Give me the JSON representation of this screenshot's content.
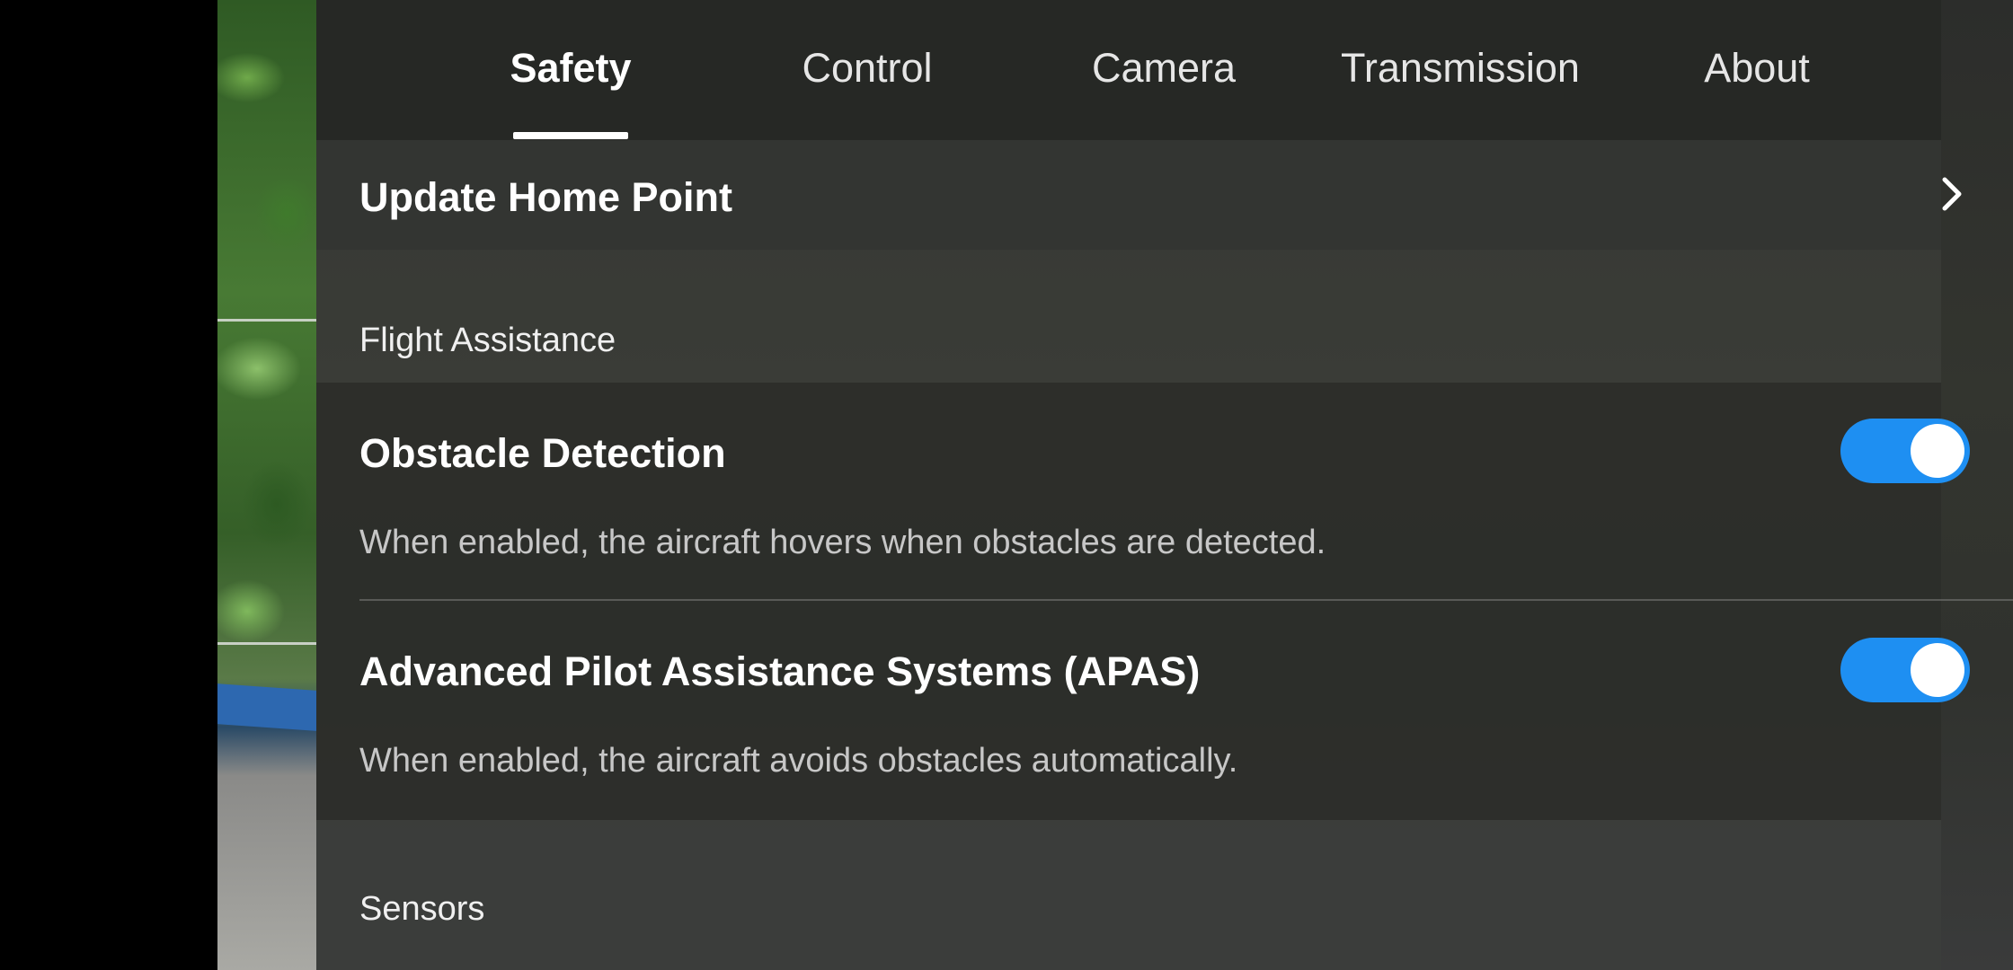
{
  "tabs": [
    {
      "label": "Safety",
      "active": true
    },
    {
      "label": "Control",
      "active": false
    },
    {
      "label": "Camera",
      "active": false
    },
    {
      "label": "Transmission",
      "active": false
    },
    {
      "label": "About",
      "active": false
    }
  ],
  "home_point": {
    "label": "Update Home Point",
    "icon": "chevron-right-icon"
  },
  "flight_assistance": {
    "section_label": "Flight Assistance",
    "obstacle_detection": {
      "title": "Obstacle Detection",
      "description": "When enabled, the aircraft hovers when obstacles are detected.",
      "enabled": true
    },
    "apas": {
      "title": "Advanced Pilot Assistance Systems (APAS)",
      "description": "When enabled, the aircraft avoids obstacles automatically.",
      "enabled": true
    }
  },
  "sensors": {
    "section_label": "Sensors"
  },
  "colors": {
    "toggle_on": "#1e8ff2",
    "text_primary": "#ffffff",
    "text_secondary": "#c7c7c7"
  }
}
